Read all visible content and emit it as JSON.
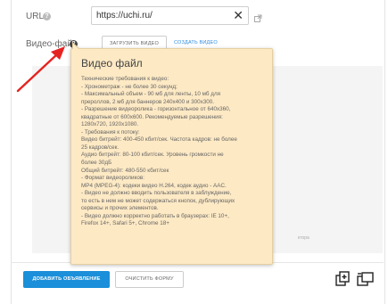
{
  "form": {
    "url_label": "URL",
    "url_value": "https://uchi.ru/",
    "video_label": "Видео-файл",
    "upload_button": "ЗАГРУЗИТЬ ВИДЕО",
    "create_link": "СОЗДАТЬ ВИДЕО",
    "area_hint": "ктора"
  },
  "tooltip": {
    "title": "Видео файл",
    "lines": [
      "Технические требования к видео:",
      "- Хронометраж - не более 30 секунд;",
      "- Максимальный объем - 90 мб для ленты, 10 мб для",
      "прероллов, 2 мб для баннеров 240x400 и 300x300.",
      "- Разрешение видеоролика - горизонтальное от 640x360,",
      "квадратные от 600x600. Рекомендуемые разрешения:",
      "1280x720, 1920x1080.",
      "- Требования к потоку:",
      "Видео битрейт: 400-450 кбит/сек. Частота кадров: не более",
      "25 кадров/сек.",
      "Аудио битрейт: 80-100 кбит/сек. Уровень громкости не",
      "более 30дБ",
      "Общий битрейт: 480-550 кбит/сек",
      "- Формат видеороликов:",
      "MP4 (MPEG-4): кодеки видео H.264, кодек аудио - AAC.",
      "- Видео не должно вводить пользователя в заблуждение,",
      "то есть в нем не может содержаться кнопок, дублирующих",
      "сервисы и прочих элементов.",
      "- Видео должно корректно работать в браузерах: IE 10+,",
      "Firefox 14+, Safari 5+, Chrome 18+"
    ]
  },
  "footer": {
    "submit_button": "ДОБАВИТЬ ОБЪЯВЛЕНИЕ",
    "clear_button": "ОЧИСТИТЬ ФОРМУ"
  },
  "icons": {
    "help": "help-icon",
    "clear": "close-icon",
    "external": "external-link-icon",
    "tool_left": "copy-plus-icon",
    "tool_right": "copy-icon"
  },
  "colors": {
    "accent": "#1b8fd9",
    "link": "#2d8be0",
    "tooltip_bg": "#fde9c4",
    "arrow": "#e52421"
  }
}
